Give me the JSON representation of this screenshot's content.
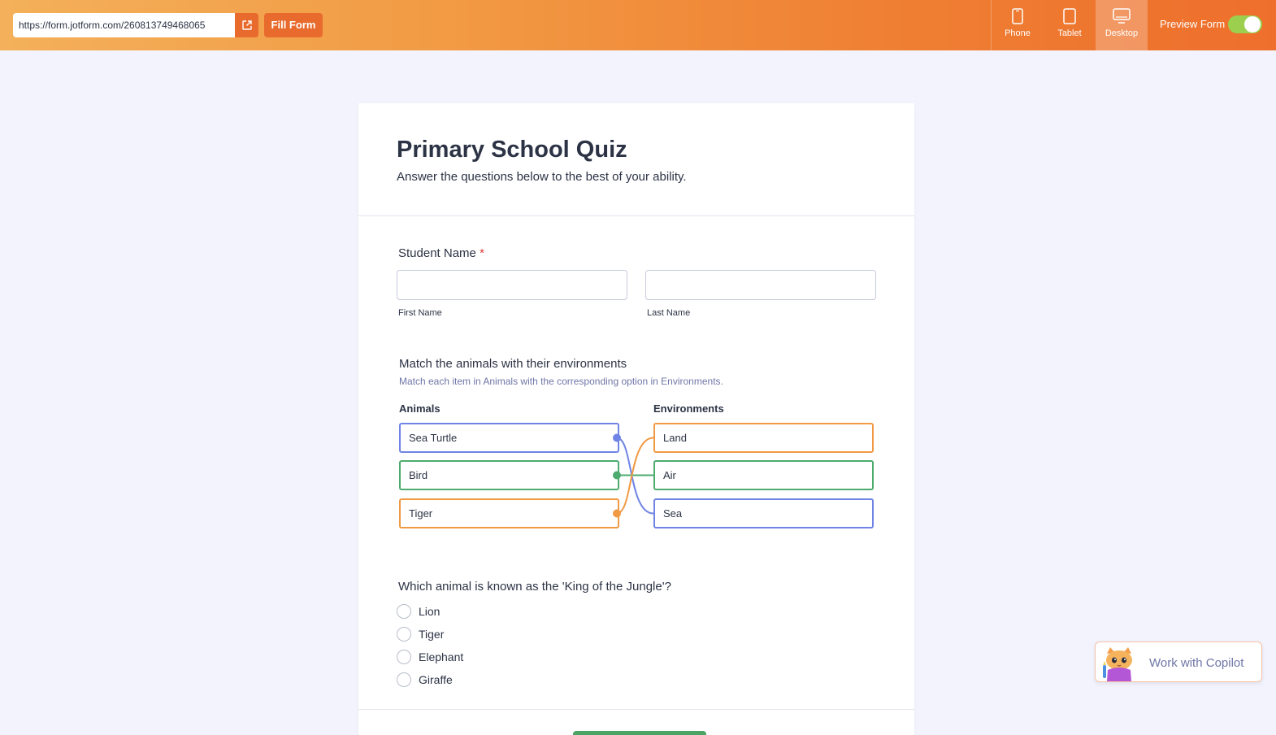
{
  "topbar": {
    "url": "https://form.jotform.com/260813749468065",
    "fill_form_label": "Fill Form",
    "devices": [
      {
        "label": "Phone",
        "icon": "phone-icon",
        "active": false
      },
      {
        "label": "Tablet",
        "icon": "tablet-icon",
        "active": false
      },
      {
        "label": "Desktop",
        "icon": "desktop-icon",
        "active": true
      }
    ],
    "preview_label": "Preview Form",
    "preview_on": true
  },
  "form": {
    "title": "Primary School Quiz",
    "subtitle": "Answer the questions below to the best of your ability.",
    "student_name": {
      "label": "Student Name",
      "required_mark": "*",
      "first_label": "First Name",
      "last_label": "Last Name"
    },
    "matching": {
      "label": "Match the animals with their environments",
      "description": "Match each item in Animals with the corresponding option in Environments.",
      "left_header": "Animals",
      "right_header": "Environments",
      "left_items": [
        "Sea Turtle",
        "Bird",
        "Tiger"
      ],
      "right_items": [
        "Land",
        "Air",
        "Sea"
      ],
      "pairs": [
        {
          "left": "Sea Turtle",
          "right": "Sea",
          "color": "#6f84e4"
        },
        {
          "left": "Bird",
          "right": "Air",
          "color": "#4dab6e"
        },
        {
          "left": "Tiger",
          "right": "Land",
          "color": "#f09a44"
        }
      ]
    },
    "king_question": {
      "label": "Which animal is known as the 'King of the Jungle'?",
      "options": [
        "Lion",
        "Tiger",
        "Elephant",
        "Giraffe"
      ]
    }
  },
  "copilot": {
    "label": "Work with Copilot"
  },
  "colors": {
    "accent": "#ee6f2c",
    "blue": "#6f84e4",
    "green": "#4dab6e",
    "orange": "#f09a44"
  }
}
